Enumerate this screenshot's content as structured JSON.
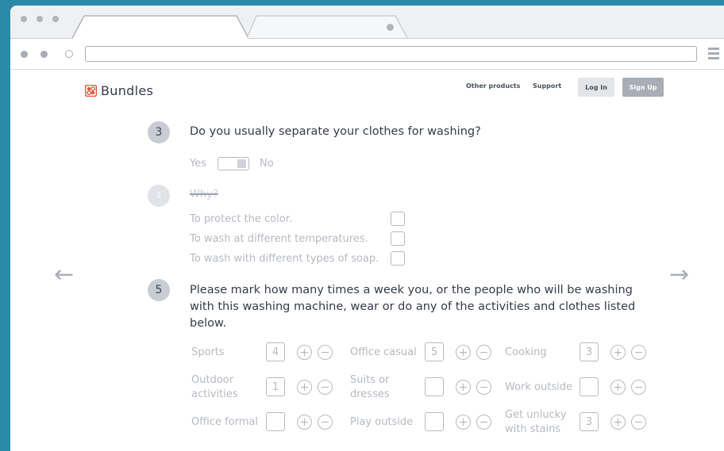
{
  "header": {
    "brand": "Bundles",
    "nav": [
      "Other products",
      "Support"
    ],
    "login_label": "Log In",
    "signup_label": "Sign Up"
  },
  "q3": {
    "number": "3",
    "text": "Do you usually separate your clothes for washing?",
    "yes_label": "Yes",
    "no_label": "No"
  },
  "q4": {
    "number": "4",
    "text": "Why?",
    "options": [
      "To protect the color.",
      "To wash  at different temperatures.",
      "To wash with different types of soap."
    ]
  },
  "q5": {
    "number": "5",
    "text": "Please mark how many times a week you, or the people who will be washing with this washing machine, wear or do any of the activities and clothes  listed below.",
    "activities": [
      {
        "label": "Sports",
        "value": "4"
      },
      {
        "label": "Office casual",
        "value": "5"
      },
      {
        "label": "Cooking",
        "value": "3"
      },
      {
        "label": "Outdoor activities",
        "value": "1"
      },
      {
        "label": "Suits or dresses",
        "value": ""
      },
      {
        "label": "Work outside",
        "value": ""
      },
      {
        "label": "Office formal",
        "value": ""
      },
      {
        "label": "Play outside",
        "value": ""
      },
      {
        "label": "Get unlucky with stains",
        "value": "3"
      }
    ],
    "plus_symbol": "+",
    "minus_symbol": "−"
  },
  "icons": {
    "prev": "arrow-left-icon",
    "next": "arrow-right-icon",
    "logo": "bundles-logo-icon"
  },
  "colors": {
    "accent": "#e2553f",
    "background": "#2a8aa8"
  }
}
